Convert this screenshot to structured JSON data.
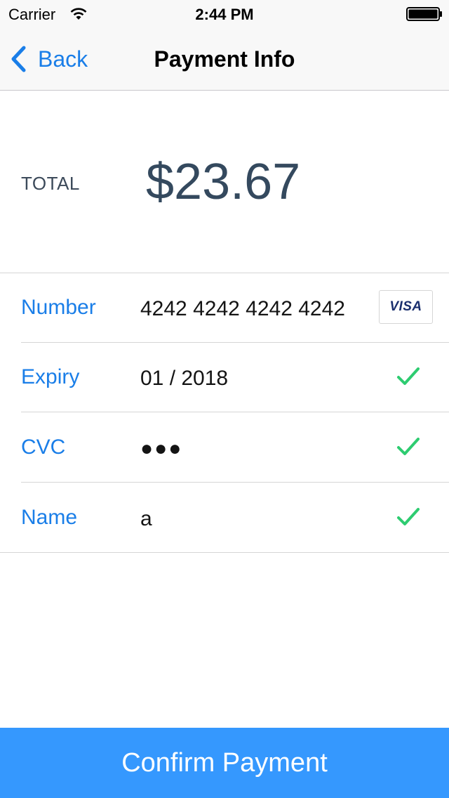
{
  "status_bar": {
    "carrier": "Carrier",
    "time": "2:44 PM",
    "wifi_icon": "wifi-icon",
    "battery_icon": "battery-icon"
  },
  "nav": {
    "back_label": "Back",
    "back_icon": "chevron-left-icon",
    "title": "Payment Info"
  },
  "total": {
    "label": "TOTAL",
    "amount": "$23.67"
  },
  "form": {
    "rows": [
      {
        "label": "Number",
        "value": "4242 4242 4242 4242",
        "indicator": "visa-card-icon",
        "indicator_text": "VISA"
      },
      {
        "label": "Expiry",
        "value": "01 / 2018",
        "indicator": "check-icon"
      },
      {
        "label": "CVC",
        "value": "●●●",
        "indicator": "check-icon"
      },
      {
        "label": "Name",
        "value": "a",
        "indicator": "check-icon"
      }
    ]
  },
  "confirm_button": {
    "label": "Confirm Payment"
  },
  "colors": {
    "accent": "#1a7ee8",
    "button": "#3598fe",
    "total_text": "#34495e",
    "check": "#2ecc71"
  }
}
